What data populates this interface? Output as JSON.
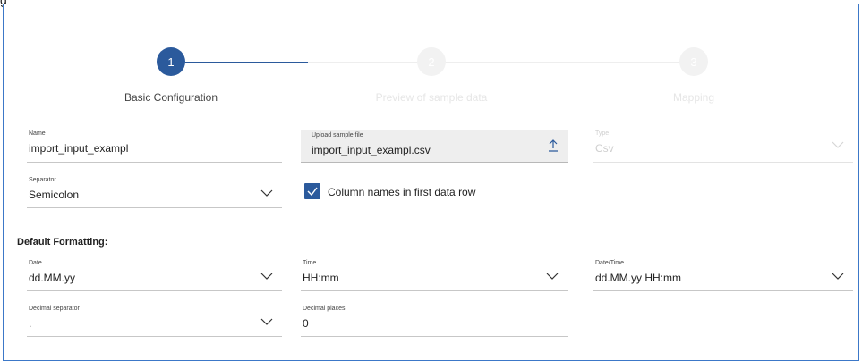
{
  "top_text": "g",
  "stepper": {
    "steps": [
      {
        "number": "1",
        "label": "Basic Configuration",
        "state": "active"
      },
      {
        "number": "2",
        "label": "Preview of sample data",
        "state": "inactive"
      },
      {
        "number": "3",
        "label": "Mapping",
        "state": "inactive"
      }
    ]
  },
  "form": {
    "name": {
      "label": "Name",
      "value": "import_input_exampl"
    },
    "upload": {
      "label": "Upload sample file",
      "value": "import_input_exampl.csv",
      "icon": "upload-icon"
    },
    "type": {
      "label": "Type",
      "value": "Csv",
      "disabled": true
    },
    "separator": {
      "label": "Separator",
      "value": "Semicolon"
    },
    "column_names": {
      "label": "Column names in first data row",
      "checked": true
    }
  },
  "default_formatting": {
    "title": "Default Formatting:",
    "date": {
      "label": "Date",
      "value": "dd.MM.yy"
    },
    "time": {
      "label": "Time",
      "value": "HH:mm"
    },
    "datetime": {
      "label": "Date/Time",
      "value": "dd.MM.yy HH:mm"
    },
    "decimal_separator": {
      "label": "Decimal separator",
      "value": "."
    },
    "decimal_places": {
      "label": "Decimal places",
      "value": "0"
    }
  },
  "colors": {
    "accent": "#2b5a9c",
    "inactive": "#eeeeee",
    "frame": "#3c78c8"
  }
}
